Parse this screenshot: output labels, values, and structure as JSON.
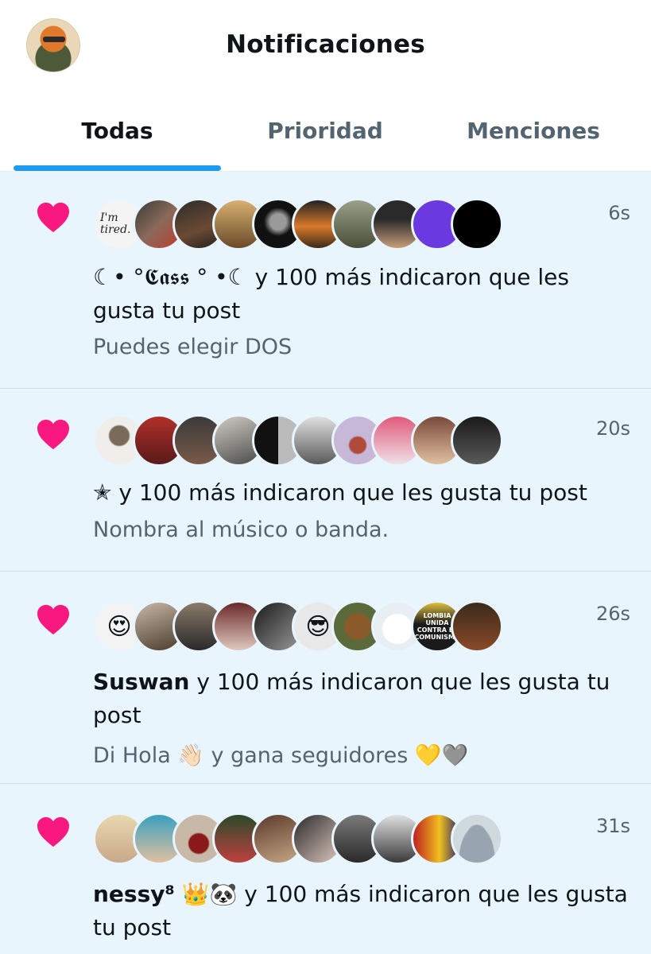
{
  "header": {
    "title": "Notificaciones",
    "profile_avatar": "profile-avatar"
  },
  "tabs": [
    {
      "label": "Todas",
      "active": true
    },
    {
      "label": "Prioridad",
      "active": false
    },
    {
      "label": "Menciones",
      "active": false
    }
  ],
  "colors": {
    "accent": "#1d9bf0",
    "heart": "#f91880",
    "feed_bg": "#e8f5fd",
    "secondary_text": "#536471"
  },
  "notifications": [
    {
      "icon": "heart-icon",
      "time": "6s",
      "name": "☾• °𝕮𝖆𝖘𝖘 ° •☾",
      "name_bold": false,
      "action": " y 100 más indicaron que les gusta tu post",
      "post": "Puedes elegir DOS",
      "avatar_text": "I'm tired."
    },
    {
      "icon": "heart-icon",
      "time": "20s",
      "name": "✭",
      "name_bold": false,
      "action": " y 100 más indicaron que les gusta tu post",
      "post": "Nombra al músico o banda."
    },
    {
      "icon": "heart-icon",
      "time": "26s",
      "name": "Suswan",
      "name_bold": true,
      "action": " y 100 más indicaron que les gusta tu post",
      "post": "Di Hola 👋🏻 y gana seguidores 💛🩶",
      "avatar_text": "LOMBIA UNIDA CONTRA EL COMUNISMO"
    },
    {
      "icon": "heart-icon",
      "time": "31s",
      "name": "nessy⁸",
      "name_bold": true,
      "action": " 👑🐼 y 100 más indicaron que les gusta tu post",
      "post": ""
    }
  ]
}
